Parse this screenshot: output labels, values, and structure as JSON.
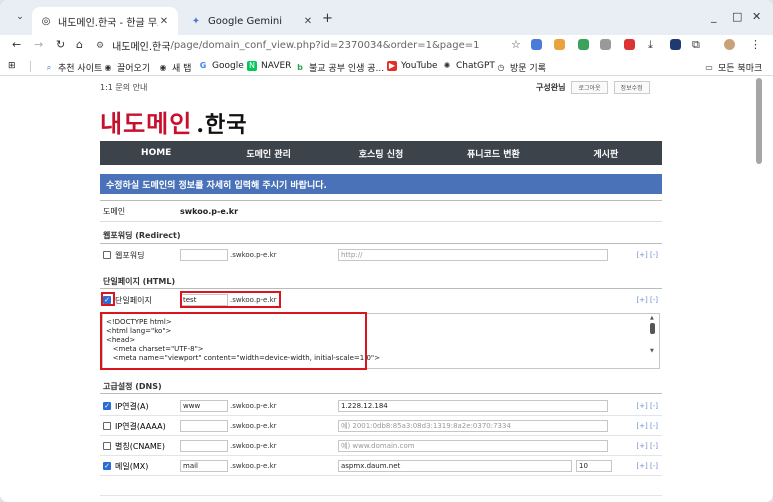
{
  "browser": {
    "tabs": [
      {
        "title": "내도메인.한국 - 한글 무료 도메",
        "active": true
      },
      {
        "title": "Google Gemini",
        "active": false
      }
    ],
    "new_tab": "+",
    "url_host": "내도메인.한국",
    "url_path": "/page/domain_conf_view.php?id=2370034&order=1&page=1",
    "window_controls": [
      "_",
      "□",
      "✕"
    ]
  },
  "bookmarks": {
    "items": [
      "추천 사이트",
      "끌어오기",
      "새 탭",
      "Google",
      "NAVER",
      "불교 공부 인생 공...",
      "YouTube",
      "ChatGPT",
      "방문 기록"
    ],
    "all_bookmarks": "모든 북마크"
  },
  "site": {
    "top_link": "1:1 문의 안내",
    "user_name": "구성완님",
    "logout": "로그아웃",
    "profile": "정보수정",
    "logo_main": "내도메인",
    "logo_han": ".한국",
    "nav": [
      "HOME",
      "도메인 관리",
      "호스팅 신청",
      "퓨니코드 변환",
      "게시판"
    ],
    "notice": "수정하실 도메인의 정보를 자세히 입력해 주시기 바랍니다.",
    "domain_label": "도메인",
    "domain_value": "swkoo.p-e.kr",
    "plus_minus": "[+] [-]",
    "sections": {
      "redirect": "웹포워딩 (Redirect)",
      "html": "단일페이지 (HTML)",
      "dns": "고급설정 (DNS)"
    },
    "forwarding": {
      "label": "웹포워딩",
      "host": "",
      "suffix": ".swkoo.p-e.kr",
      "url_placeholder": "http://"
    },
    "single_page": {
      "label": "단일페이지",
      "host": "test",
      "suffix": ".swkoo.p-e.kr",
      "html": "<!DOCTYPE html>\n<html lang=\"ko\">\n<head>\n   <meta charset=\"UTF-8\">\n   <meta name=\"viewport\" content=\"width=device-width, initial-scale=1.0\">"
    },
    "dns_rows": [
      {
        "label": "IP연결(A)",
        "checked": true,
        "host": "www",
        "suffix": ".swkoo.p-e.kr",
        "value": "1.228.12.184",
        "placeholder": "",
        "priority": ""
      },
      {
        "label": "IP연결(AAAA)",
        "checked": false,
        "host": "",
        "suffix": ".swkoo.p-e.kr",
        "value": "",
        "placeholder": "예) 2001:0db8:85a3:08d3:1319:8a2e:0370:7334",
        "priority": ""
      },
      {
        "label": "별칭(CNAME)",
        "checked": false,
        "host": "",
        "suffix": ".swkoo.p-e.kr",
        "value": "",
        "placeholder": "예) www.domain.com",
        "priority": ""
      },
      {
        "label": "메일(MX)",
        "checked": true,
        "host": "mail",
        "suffix": ".swkoo.p-e.kr",
        "value": "aspmx.daum.net",
        "placeholder": "",
        "priority": "10"
      }
    ]
  }
}
